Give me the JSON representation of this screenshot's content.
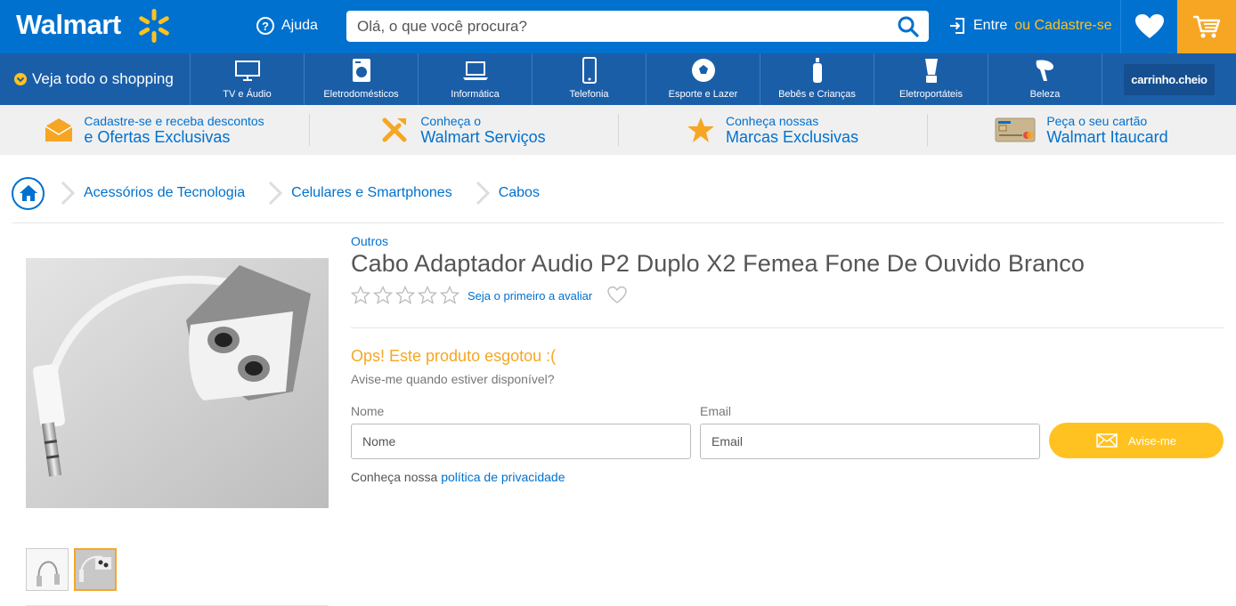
{
  "header": {
    "logo": "Walmart",
    "help_label": "Ajuda",
    "search_placeholder": "Olá, o que você procura?",
    "login_label": "Entre",
    "signup_label": "ou Cadastre-se",
    "colors": {
      "primary": "#0071ce",
      "accent": "#ffc220",
      "cart": "#f6a623"
    }
  },
  "nav": {
    "all_label": "Veja todo o shopping",
    "items": [
      {
        "label": "TV e Áudio",
        "icon": "tv-icon"
      },
      {
        "label": "Eletrodomésticos",
        "icon": "washer-icon"
      },
      {
        "label": "Informática",
        "icon": "laptop-icon"
      },
      {
        "label": "Telefonia",
        "icon": "phone-icon"
      },
      {
        "label": "Esporte e Lazer",
        "icon": "ball-icon"
      },
      {
        "label": "Bebês e Crianças",
        "icon": "bottle-icon"
      },
      {
        "label": "Eletroportáteis",
        "icon": "blender-icon"
      },
      {
        "label": "Beleza",
        "icon": "hairdryer-icon"
      }
    ],
    "cheio_label": "carrinho.cheio"
  },
  "promo": [
    {
      "small": "Cadastre-se e receba descontos",
      "big": "e Ofertas Exclusivas",
      "icon": "envelope-icon"
    },
    {
      "small": "Conheça o",
      "big": "Walmart Serviços",
      "icon": "tools-icon"
    },
    {
      "small": "Conheça nossas",
      "big": "Marcas Exclusivas",
      "icon": "star-icon"
    },
    {
      "small": "Peça o seu cartão",
      "big": "Walmart Itaucard",
      "icon": "credit-card-icon"
    }
  ],
  "breadcrumb": [
    "Acessórios de Tecnologia",
    "Celulares e Smartphones",
    "Cabos"
  ],
  "product": {
    "brand": "Outros",
    "title": "Cabo Adaptador Audio P2 Duplo X2 Femea Fone De Ouvido Branco",
    "rating_text": "Seja o primeiro a avaliar",
    "stars": 0,
    "out_of_stock": "Ops! Este produto esgotou :(",
    "notify_text": "Avise-me quando estiver disponível?",
    "name_label": "Nome",
    "name_placeholder": "Nome",
    "email_label": "Email",
    "email_placeholder": "Email",
    "notify_button": "Avise-me",
    "privacy_prefix": "Conheça nossa",
    "privacy_link": "política de privacidade"
  }
}
